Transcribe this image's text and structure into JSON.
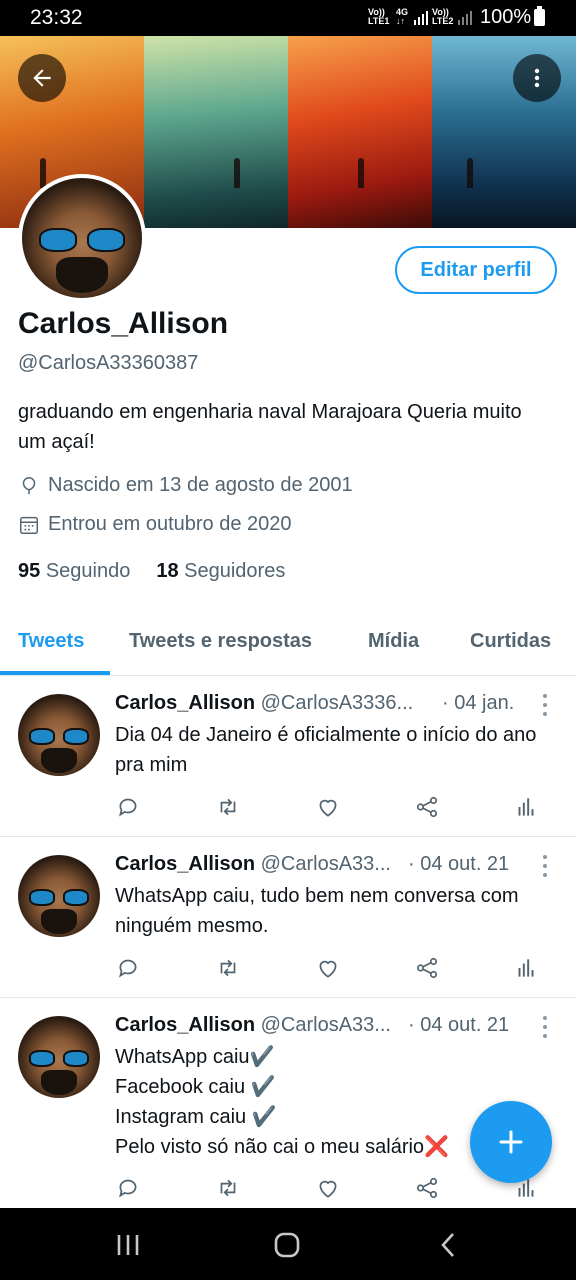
{
  "status_bar": {
    "time": "23:32",
    "sim1_top": "Vo))",
    "sim1_bottom": "LTE1",
    "net_top": "4G",
    "net_bottom": "↓↑",
    "sim2_top": "Vo))",
    "sim2_bottom": "LTE2",
    "battery": "100%"
  },
  "header": {
    "back_icon": "arrow-left-icon",
    "menu_icon": "more-vertical-icon"
  },
  "profile": {
    "edit_button": "Editar perfil",
    "name": "Carlos_Allison",
    "handle": "@CarlosA33360387",
    "bio": "graduando em engenharia naval  Marajoara Queria muito um açaí!",
    "birthday": "Nascido em 13 de agosto de 2001",
    "joined": "Entrou em outubro de 2020",
    "following_count": "95",
    "following_label": "Seguindo",
    "followers_count": "18",
    "followers_label": "Seguidores"
  },
  "tabs": [
    {
      "label": "Tweets",
      "active": true
    },
    {
      "label": "Tweets e respostas",
      "active": false
    },
    {
      "label": "Mídia",
      "active": false
    },
    {
      "label": "Curtidas",
      "active": false
    }
  ],
  "tweets": [
    {
      "name": "Carlos_Allison",
      "handle": "@CarlosA3336...",
      "date": "· 04 jan.",
      "text": "Dia 04 de Janeiro é oficialmente o início do ano pra mim"
    },
    {
      "name": "Carlos_Allison",
      "handle": "@CarlosA33...",
      "date": "· 04 out. 21",
      "text": "WhatsApp caiu, tudo bem  nem conversa com ninguém mesmo."
    },
    {
      "name": "Carlos_Allison",
      "handle": "@CarlosA33...",
      "date": "· 04 out. 21",
      "text": "WhatsApp caiu✔️\nFacebook caiu ✔️\nInstagram caiu ✔️\nPelo visto só não cai o meu salário❌"
    }
  ],
  "tweet_actions": [
    "reply-icon",
    "retweet-icon",
    "like-icon",
    "share-icon",
    "analytics-icon"
  ],
  "fab": {
    "icon": "compose-plus-icon"
  },
  "nav_bar": [
    "recents-icon",
    "home-icon",
    "back-icon"
  ],
  "colors": {
    "accent": "#1d9bf0",
    "text": "#0f1419",
    "secondary": "#536471"
  }
}
